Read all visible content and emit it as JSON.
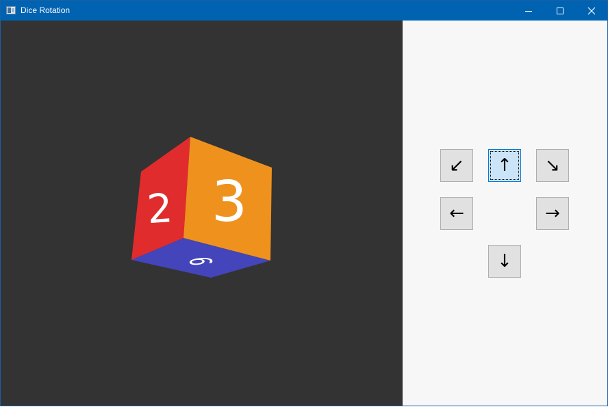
{
  "window": {
    "title": "Dice Rotation",
    "controls": [
      "minimize",
      "maximize",
      "close"
    ],
    "app_icon": "dice-app-icon",
    "accent": "#0063b1"
  },
  "viewport": {
    "background": "#333333",
    "die": {
      "visible_faces": [
        {
          "face": "left",
          "label": "2",
          "color": "#e02c2c"
        },
        {
          "face": "front",
          "label": "3",
          "color": "#ef921d"
        },
        {
          "face": "bottom",
          "label": "6",
          "color": "#4444bb"
        }
      ]
    }
  },
  "controls": {
    "buttons": [
      {
        "id": "down-left",
        "glyph": "↙",
        "icon": "arrow-down-left-icon"
      },
      {
        "id": "up",
        "glyph": "↑",
        "icon": "arrow-up-icon",
        "focused": true
      },
      {
        "id": "down-right",
        "glyph": "↘",
        "icon": "arrow-down-right-icon"
      },
      {
        "id": "left",
        "glyph": "←",
        "icon": "arrow-left-icon"
      },
      {
        "id": "right",
        "glyph": "→",
        "icon": "arrow-right-icon"
      },
      {
        "id": "down",
        "glyph": "↓",
        "icon": "arrow-down-icon"
      }
    ]
  }
}
